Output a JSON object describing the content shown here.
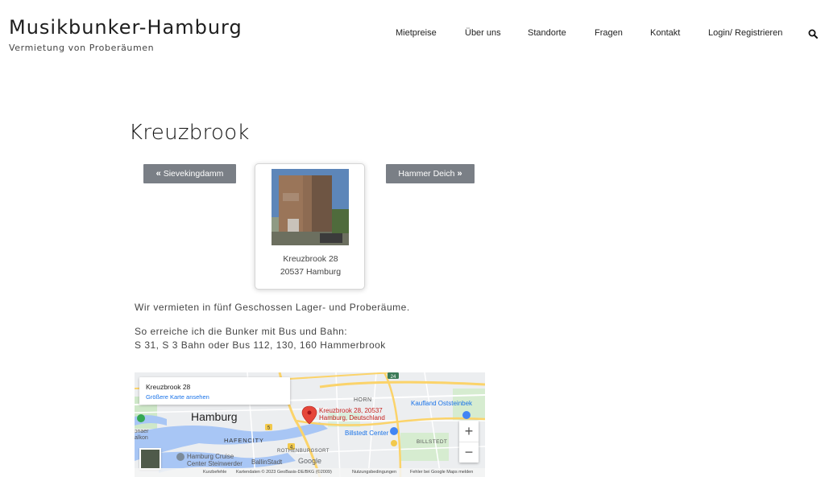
{
  "site": {
    "title": "Musikbunker-Hamburg",
    "tagline": "Vermietung von Proberäumen"
  },
  "nav": {
    "items": [
      "Mietpreise",
      "Über uns",
      "Standorte",
      "Fragen",
      "Kontakt",
      "Login/ Registrieren"
    ],
    "search_icon": "search-icon"
  },
  "page": {
    "title": "Kreuzbrook"
  },
  "pager": {
    "prev_label": "Sievekingdamm",
    "next_label": "Hammer Deich",
    "prev_icon": "«",
    "next_icon": "»"
  },
  "card": {
    "address_line1": "Kreuzbrook 28",
    "address_line2": "20537 Hamburg"
  },
  "content": {
    "para1": "Wir vermieten in fünf Geschossen Lager- und Proberäume.",
    "para2": "So erreiche ich die Bunker mit Bus und Bahn:",
    "para3": "S 31, S 3 Bahn oder Bus 112, 130, 160 Hammerbrook"
  },
  "map": {
    "place_title": "Kreuzbrook 28",
    "larger_map_link": "Größere Karte ansehen",
    "labels": {
      "city": "Hamburg",
      "horn": "HORN",
      "kaufland": "Kaufland Oststeinbek",
      "pin_line1": "Kreuzbrook 28, 20537",
      "pin_line2": "Hamburg, Deutschland",
      "billstedt_center": "Billstedt Center",
      "billstedt": "BILLSTEDT",
      "hafencity": "HAFENCITY",
      "rothenburgsort": "ROTHENBURGSORT",
      "cruise_line1": "Hamburg Cruise",
      "cruise_line2": "Center Steinwerder",
      "ballinstadt": "BallinStadt",
      "google": "Google",
      "fonaer_line1": "ɔnaer",
      "fonaer_line2": "alkon"
    },
    "road_badges": [
      "24",
      "5",
      "4"
    ],
    "zoom_in": "+",
    "zoom_out": "−",
    "footer": {
      "shortcuts": "Kurzbefehle",
      "attribution": "Kartendaten © 2023 GeoBasis-DE/BKG (©2009)",
      "terms": "Nutzungsbedingungen",
      "report": "Fehler bei Google Maps melden"
    },
    "colors": {
      "water": "#a8c6f5",
      "road_major": "#fbd36a",
      "road_minor": "#ffffff",
      "park": "#cfe8c9",
      "pin": "#e5463a"
    }
  },
  "colors": {
    "button_bg": "#7a7f86",
    "text": "#444444"
  }
}
